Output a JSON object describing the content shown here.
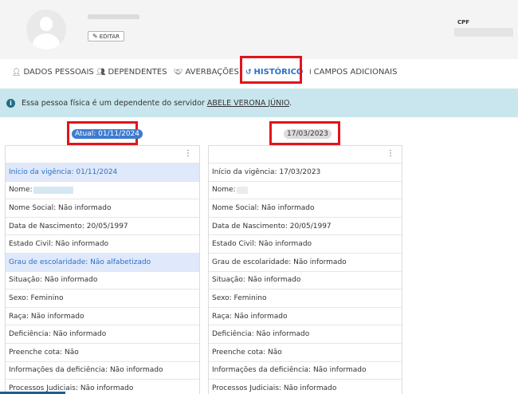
{
  "header": {
    "edit_label": "EDITAR",
    "cpf_label": "CPF"
  },
  "tabs": [
    {
      "label": "DADOS PESSOAIS",
      "icon": "user-icon"
    },
    {
      "label": "DEPENDENTES",
      "icon": "users-icon"
    },
    {
      "label": "AVERBAÇÕES",
      "icon": "handshake-icon"
    },
    {
      "label": "HISTÓRICO",
      "icon": "history-icon"
    },
    {
      "label": "CAMPOS ADICIONAIS",
      "icon": "text-cursor-icon"
    }
  ],
  "info": {
    "text": "Essa pessoa física é um dependente do servidor",
    "link": "ABELE VERONA JÚNIO",
    "suffix": "."
  },
  "versions": [
    {
      "badge": "Atual: 01/11/2024",
      "rows": [
        {
          "text": "Início da vigência: 01/11/2024",
          "changed": true
        },
        {
          "text": "Nome:",
          "changed": false
        },
        {
          "text": "Nome Social: Não informado",
          "changed": false
        },
        {
          "text": "Data de Nascimento: 20/05/1997",
          "changed": false
        },
        {
          "text": "Estado Civil: Não informado",
          "changed": false
        },
        {
          "text": "Grau de escolaridade: Não alfabetizado",
          "changed": true
        },
        {
          "text": "Situação: Não informado",
          "changed": false
        },
        {
          "text": "Sexo: Feminino",
          "changed": false
        },
        {
          "text": "Raça: Não informado",
          "changed": false
        },
        {
          "text": "Deficiência: Não informado",
          "changed": false
        },
        {
          "text": "Preenche cota: Não",
          "changed": false
        },
        {
          "text": "Informações da deficiência: Não informado",
          "changed": false
        },
        {
          "text": "Processos Judiciais: Não informado",
          "changed": false
        }
      ]
    },
    {
      "badge": "17/03/2023",
      "rows": [
        {
          "text": "Início da vigência: 17/03/2023",
          "changed": false
        },
        {
          "text": "Nome:",
          "changed": false
        },
        {
          "text": "Nome Social: Não informado",
          "changed": false
        },
        {
          "text": "Data de Nascimento: 20/05/1997",
          "changed": false
        },
        {
          "text": "Estado Civil: Não informado",
          "changed": false
        },
        {
          "text": "Grau de escolaridade: Não informado",
          "changed": false
        },
        {
          "text": "Situação: Não informado",
          "changed": false
        },
        {
          "text": "Sexo: Feminino",
          "changed": false
        },
        {
          "text": "Raça: Não informado",
          "changed": false
        },
        {
          "text": "Deficiência: Não informado",
          "changed": false
        },
        {
          "text": "Preenche cota: Não",
          "changed": false
        },
        {
          "text": "Informações da deficiência: Não informado",
          "changed": false
        },
        {
          "text": "Processos Judiciais: Não informado",
          "changed": false
        }
      ]
    }
  ],
  "colors": {
    "accent": "#2f6fc4",
    "highlight": "#e3131b",
    "info_bg": "#c9e6ee"
  }
}
